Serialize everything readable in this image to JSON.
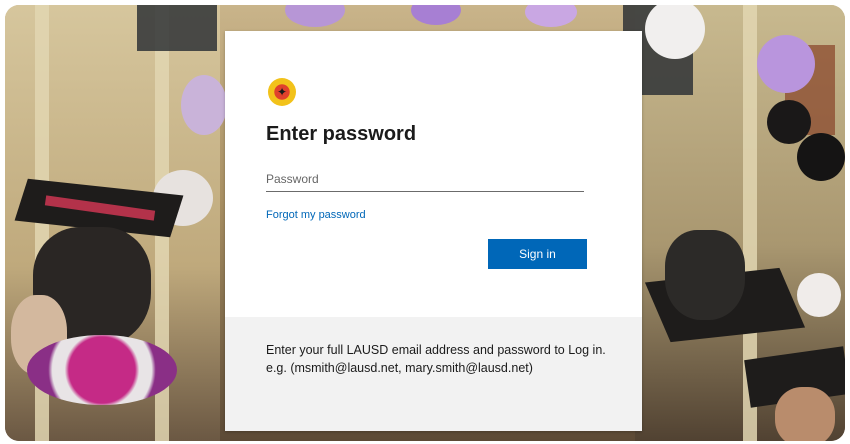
{
  "login": {
    "logo_icon": "lausd-seal-icon",
    "title": "Enter password",
    "password_placeholder": "Password",
    "password_value": "",
    "forgot_link": "Forgot my password",
    "signin_label": "Sign in",
    "footer_text": "Enter your full LAUSD email address and password to Log in. e.g. (msmith@lausd.net, mary.smith@lausd.net)"
  },
  "colors": {
    "accent": "#0067b8",
    "footer_bg": "#f2f2f2"
  },
  "background": {
    "image_icon": "graduation-photo"
  }
}
